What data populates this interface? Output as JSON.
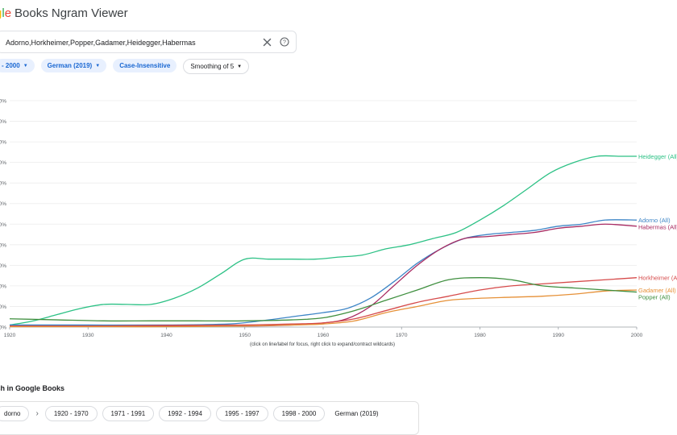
{
  "app": {
    "logo_g": "g",
    "logo_l": "l",
    "logo_e": "e",
    "product": "Books Ngram Viewer"
  },
  "search": {
    "query": "Adorno,Horkheimer,Popper,Gadamer,Heidegger,Habermas"
  },
  "filters": {
    "year_range": "- 2000",
    "corpus": "German (2019)",
    "case": "Case-Insensitive",
    "smoothing": "Smoothing of 5"
  },
  "icons": {
    "clear": "close-icon",
    "help": "help-circle-icon",
    "dropdown": "caret-down-icon"
  },
  "chart_data": {
    "type": "line",
    "x_range": [
      1920,
      2000
    ],
    "x_ticks": [
      1920,
      1930,
      1940,
      1950,
      1960,
      1970,
      1980,
      1990,
      2000
    ],
    "y_tick_labels": [
      "0%",
      "0%",
      "0%",
      "0%",
      "0%",
      "0%",
      "0%",
      "0%",
      "0%",
      "0%",
      "0%",
      "0%"
    ],
    "y_range": [
      0,
      11
    ],
    "grid": true,
    "series": [
      {
        "name": "Heidegger (All)",
        "color": "#2cc185",
        "x": [
          1920,
          1923,
          1926,
          1929,
          1932,
          1935,
          1938,
          1941,
          1944,
          1947,
          1950,
          1953,
          1956,
          1959,
          1962,
          1965,
          1968,
          1971,
          1974,
          1977,
          1980,
          1983,
          1986,
          1989,
          1992,
          1995,
          1998,
          2000
        ],
        "y": [
          0.1,
          0.3,
          0.6,
          0.9,
          1.1,
          1.1,
          1.1,
          1.4,
          1.9,
          2.6,
          3.3,
          3.3,
          3.3,
          3.3,
          3.4,
          3.5,
          3.8,
          4.0,
          4.3,
          4.6,
          5.2,
          5.9,
          6.7,
          7.5,
          8.0,
          8.3,
          8.3,
          8.3
        ]
      },
      {
        "name": "Adorno (All)",
        "color": "#3d85c6",
        "x": [
          1920,
          1930,
          1940,
          1948,
          1952,
          1956,
          1960,
          1963,
          1966,
          1969,
          1972,
          1975,
          1978,
          1981,
          1984,
          1987,
          1990,
          1993,
          1996,
          2000
        ],
        "y": [
          0.1,
          0.1,
          0.1,
          0.15,
          0.3,
          0.5,
          0.7,
          0.9,
          1.4,
          2.2,
          3.1,
          3.8,
          4.3,
          4.5,
          4.6,
          4.7,
          4.9,
          5.0,
          5.2,
          5.2
        ]
      },
      {
        "name": "Habermas (All)",
        "color": "#a82b62",
        "x": [
          1920,
          1930,
          1940,
          1950,
          1956,
          1960,
          1963,
          1966,
          1969,
          1972,
          1975,
          1978,
          1981,
          1984,
          1987,
          1990,
          1993,
          1996,
          2000
        ],
        "y": [
          0.05,
          0.05,
          0.05,
          0.05,
          0.1,
          0.2,
          0.4,
          1.0,
          2.0,
          3.0,
          3.8,
          4.3,
          4.4,
          4.5,
          4.6,
          4.8,
          4.9,
          5.0,
          4.9
        ]
      },
      {
        "name": "Horkheimer (All)",
        "color": "#d64b4b",
        "x": [
          1920,
          1930,
          1940,
          1950,
          1956,
          1960,
          1964,
          1968,
          1972,
          1976,
          1980,
          1984,
          1988,
          1992,
          1996,
          2000
        ],
        "y": [
          0.05,
          0.05,
          0.08,
          0.1,
          0.15,
          0.2,
          0.4,
          0.8,
          1.2,
          1.5,
          1.8,
          2.0,
          2.1,
          2.2,
          2.3,
          2.4
        ]
      },
      {
        "name": "Gadamer (All)",
        "color": "#e69138",
        "x": [
          1920,
          1930,
          1940,
          1950,
          1956,
          1960,
          1964,
          1968,
          1972,
          1976,
          1980,
          1984,
          1988,
          1992,
          1996,
          2000
        ],
        "y": [
          0.02,
          0.02,
          0.02,
          0.05,
          0.1,
          0.15,
          0.3,
          0.7,
          1.0,
          1.3,
          1.4,
          1.45,
          1.5,
          1.6,
          1.75,
          1.8
        ]
      },
      {
        "name": "Popper (All)",
        "color": "#3f8f3f",
        "x": [
          1920,
          1926,
          1932,
          1938,
          1944,
          1950,
          1956,
          1960,
          1964,
          1968,
          1972,
          1976,
          1980,
          1984,
          1988,
          1992,
          1996,
          2000
        ],
        "y": [
          0.4,
          0.35,
          0.3,
          0.3,
          0.3,
          0.3,
          0.35,
          0.45,
          0.8,
          1.3,
          1.8,
          2.3,
          2.4,
          2.3,
          2.0,
          1.9,
          1.8,
          1.7
        ]
      }
    ]
  },
  "chart_hint": "(click on line/label for focus, right click to expand/contract wildcards)",
  "books": {
    "title": "rch in Google Books",
    "term": "dorno",
    "ranges": [
      "1920 - 1970",
      "1971 - 1991",
      "1992 - 1994",
      "1995 - 1997",
      "1998 - 2000"
    ],
    "corpus": "German (2019)"
  }
}
